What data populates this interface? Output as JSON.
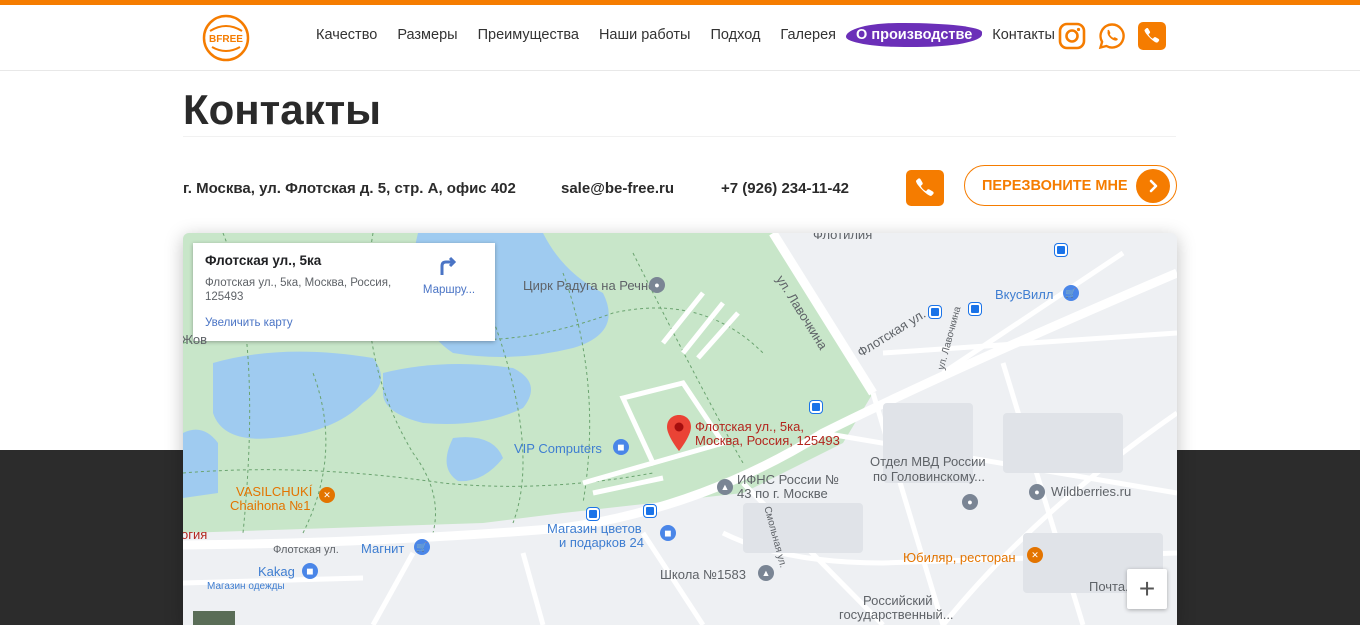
{
  "brand": {
    "logo_text": "BFREE",
    "accent": "#f57c00"
  },
  "nav": {
    "items": [
      {
        "label": "Качество"
      },
      {
        "label": "Размеры"
      },
      {
        "label": "Преимущества"
      },
      {
        "label": "Наши работы"
      },
      {
        "label": "Подход"
      },
      {
        "label": "Галерея"
      },
      {
        "label": "О производстве",
        "active": true
      },
      {
        "label": "Контакты"
      }
    ]
  },
  "social": [
    "instagram-icon",
    "whatsapp-icon",
    "phone-icon"
  ],
  "page": {
    "title": "Контакты"
  },
  "contacts": {
    "address": "г. Москва, ул. Флотская д. 5, стр. А, офис 402",
    "email": "sale@be-free.ru",
    "phone": "+7 (926) 234-11-42",
    "callback_label": "ПЕРЕЗВОНИТЕ МНЕ"
  },
  "map": {
    "card": {
      "title": "Флотская ул., 5ка",
      "address": "Флотская ул., 5ка, Москва, Россия, 125493",
      "route_label": "Маршру...",
      "enlarge_label": "Увеличить карту"
    },
    "labels": {
      "flotiliya": "Флотилия",
      "circus": "Цирк Радуга на Речном",
      "lavochkina_1": "ул. Лавочкина",
      "flotskaya_1": "Флотская ул.",
      "vkusvill": "ВкусВилл",
      "lavochkina_2": "ул. Лавочкина",
      "marker_line1": "Флотская ул., 5ка,",
      "marker_line2": "Москва, Россия, 125493",
      "vip": "VIP Computers",
      "ifns_1": "ИФНС России №",
      "ifns_2": "43 по г. Москве",
      "mvd_1": "Отдел МВД России",
      "mvd_2": "по Головинскому...",
      "wildberries": "Wildberries.ru",
      "vasil_1": "VASILCHUKÍ",
      "vasil_2": "Chaihona №1",
      "magnit": "Магнит",
      "flowers_1": "Магазин цветов",
      "flowers_2": "и подарков 24",
      "smolnaya": "Смольная ул.",
      "flotskaya_2": "Флотская ул.",
      "yubilyar": "Юбиляр, ресторан",
      "kakag": "Kakag",
      "kakag_sub": "Магазин одежды",
      "school": "Школа №1583",
      "post": "Почта...",
      "uni_1": "Российский",
      "uni_2": "государственный...",
      "edge_left": "Жов",
      "edge_red": "огия"
    },
    "zoom_in_label": "+"
  }
}
